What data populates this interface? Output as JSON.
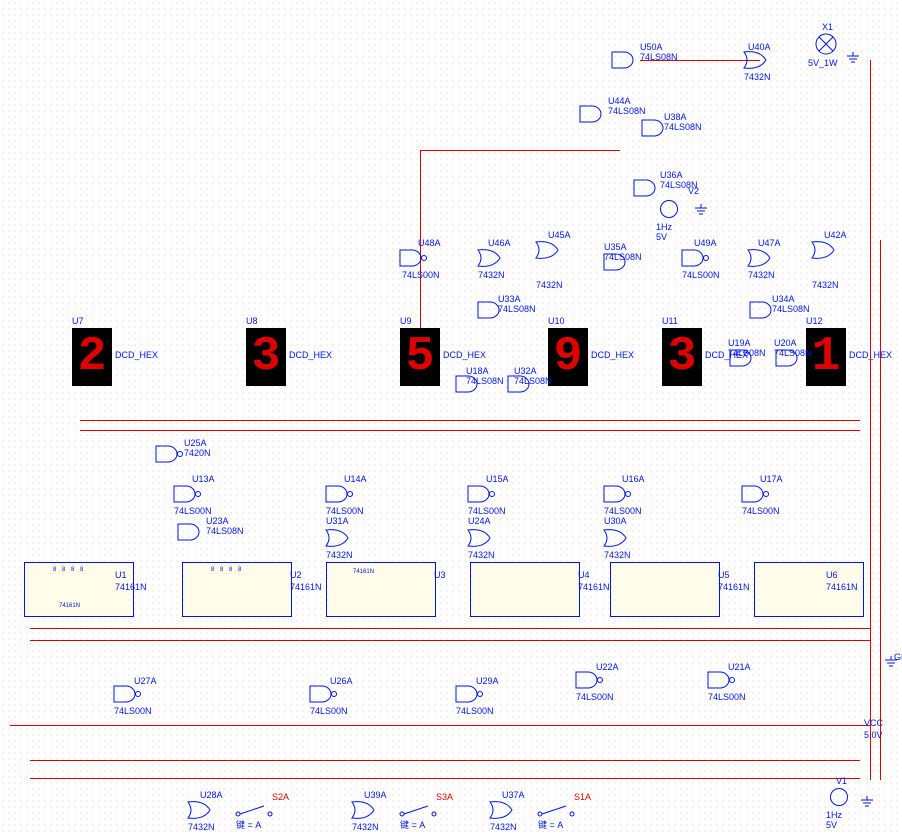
{
  "displays": [
    {
      "ref": "U7",
      "type": "DCD_HEX",
      "digit": "2"
    },
    {
      "ref": "U8",
      "type": "DCD_HEX",
      "digit": "3"
    },
    {
      "ref": "U9",
      "type": "DCD_HEX",
      "digit": "5"
    },
    {
      "ref": "U10",
      "type": "DCD_HEX",
      "digit": "9"
    },
    {
      "ref": "U11",
      "type": "DCD_HEX",
      "digit": "3"
    },
    {
      "ref": "U12",
      "type": "DCD_HEX",
      "digit": "1"
    }
  ],
  "counters": [
    {
      "ref": "U1",
      "type": "74161N"
    },
    {
      "ref": "U2",
      "type": "74161N"
    },
    {
      "ref": "U3",
      "type": "74161N"
    },
    {
      "ref": "U4",
      "type": "74161N"
    },
    {
      "ref": "U5",
      "type": "74161N"
    },
    {
      "ref": "U6",
      "type": "74161N"
    }
  ],
  "gates": [
    {
      "ref": "U50A",
      "type": "74LS08N",
      "kind": "and"
    },
    {
      "ref": "U40A",
      "type": "7432N",
      "kind": "or"
    },
    {
      "ref": "U44A",
      "type": "74LS08N",
      "kind": "and"
    },
    {
      "ref": "U38A",
      "type": "74LS08N",
      "kind": "and"
    },
    {
      "ref": "U36A",
      "type": "74LS08N",
      "kind": "and"
    },
    {
      "ref": "U48A",
      "type": "74LS00N",
      "kind": "nand"
    },
    {
      "ref": "U46A",
      "type": "7432N",
      "kind": "or"
    },
    {
      "ref": "U45A",
      "type": "7432N",
      "kind": "or"
    },
    {
      "ref": "U35A",
      "type": "74LS08N",
      "kind": "and"
    },
    {
      "ref": "U49A",
      "type": "74LS00N",
      "kind": "nand"
    },
    {
      "ref": "U47A",
      "type": "7432N",
      "kind": "or"
    },
    {
      "ref": "U42A",
      "type": "7432N",
      "kind": "or"
    },
    {
      "ref": "U33A",
      "type": "74LS08N",
      "kind": "and"
    },
    {
      "ref": "U34A",
      "type": "74LS08N",
      "kind": "and"
    },
    {
      "ref": "U19A",
      "type": "74LS08N",
      "kind": "and"
    },
    {
      "ref": "U20A",
      "type": "74LS08N",
      "kind": "and"
    },
    {
      "ref": "U18A",
      "type": "74LS08N",
      "kind": "and"
    },
    {
      "ref": "U32A",
      "type": "74LS08N",
      "kind": "and"
    },
    {
      "ref": "U25A",
      "type": "7420N",
      "kind": "nand"
    },
    {
      "ref": "U13A",
      "type": "74LS00N",
      "kind": "nand"
    },
    {
      "ref": "U23A",
      "type": "74LS08N",
      "kind": "and"
    },
    {
      "ref": "U14A",
      "type": "74LS00N",
      "kind": "nand"
    },
    {
      "ref": "U31A",
      "type": "7432N",
      "kind": "or"
    },
    {
      "ref": "U15A",
      "type": "74LS00N",
      "kind": "nand"
    },
    {
      "ref": "U24A",
      "type": "7432N",
      "kind": "or"
    },
    {
      "ref": "U16A",
      "type": "74LS00N",
      "kind": "nand"
    },
    {
      "ref": "U30A",
      "type": "7432N",
      "kind": "or"
    },
    {
      "ref": "U17A",
      "type": "74LS00N",
      "kind": "nand"
    },
    {
      "ref": "U27A",
      "type": "74LS00N",
      "kind": "nand"
    },
    {
      "ref": "U26A",
      "type": "74LS00N",
      "kind": "nand"
    },
    {
      "ref": "U29A",
      "type": "74LS00N",
      "kind": "nand"
    },
    {
      "ref": "U22A",
      "type": "74LS00N",
      "kind": "nand"
    },
    {
      "ref": "U21A",
      "type": "74LS00N",
      "kind": "nand"
    },
    {
      "ref": "U28A",
      "type": "7432N",
      "kind": "or"
    },
    {
      "ref": "U39A",
      "type": "7432N",
      "kind": "or"
    },
    {
      "ref": "U37A",
      "type": "7432N",
      "kind": "or"
    }
  ],
  "switches": [
    {
      "ref": "S2A",
      "label": "键 = A"
    },
    {
      "ref": "S3A",
      "label": "键 = A"
    },
    {
      "ref": "S1A",
      "label": "键 = A"
    }
  ],
  "sources": [
    {
      "ref": "V2",
      "freq": "1Hz",
      "volt": "5V"
    },
    {
      "ref": "V1",
      "freq": "1Hz",
      "volt": "5V"
    }
  ],
  "lamp": {
    "ref": "X1",
    "label": "5V_1W"
  },
  "rails": {
    "vcc": "VCC",
    "vcc_volt": "5.0V",
    "gnd": "GN"
  },
  "counter_inner_label": "74161N",
  "ic_pin_hint": "8 8 8 8"
}
